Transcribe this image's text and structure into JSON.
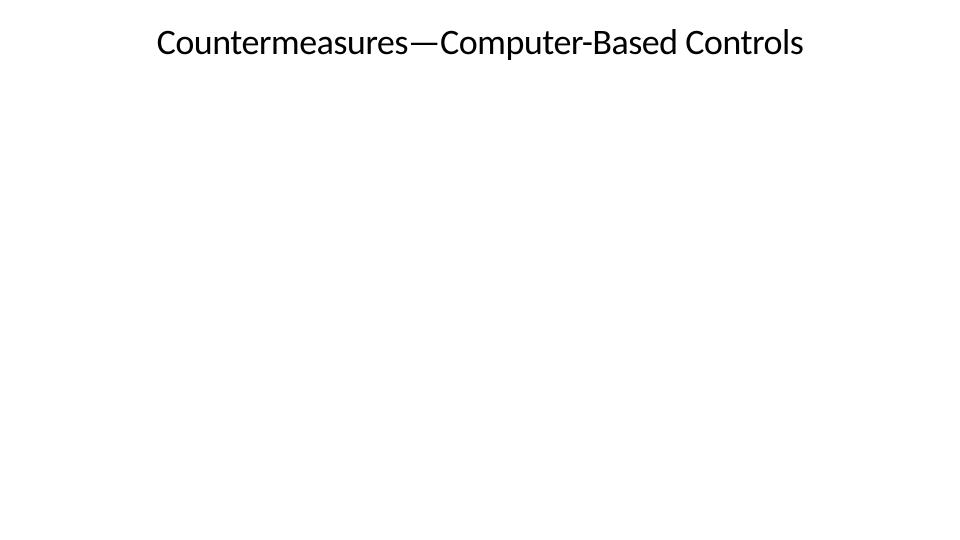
{
  "slide": {
    "title": "Countermeasures—Computer-Based Controls"
  }
}
